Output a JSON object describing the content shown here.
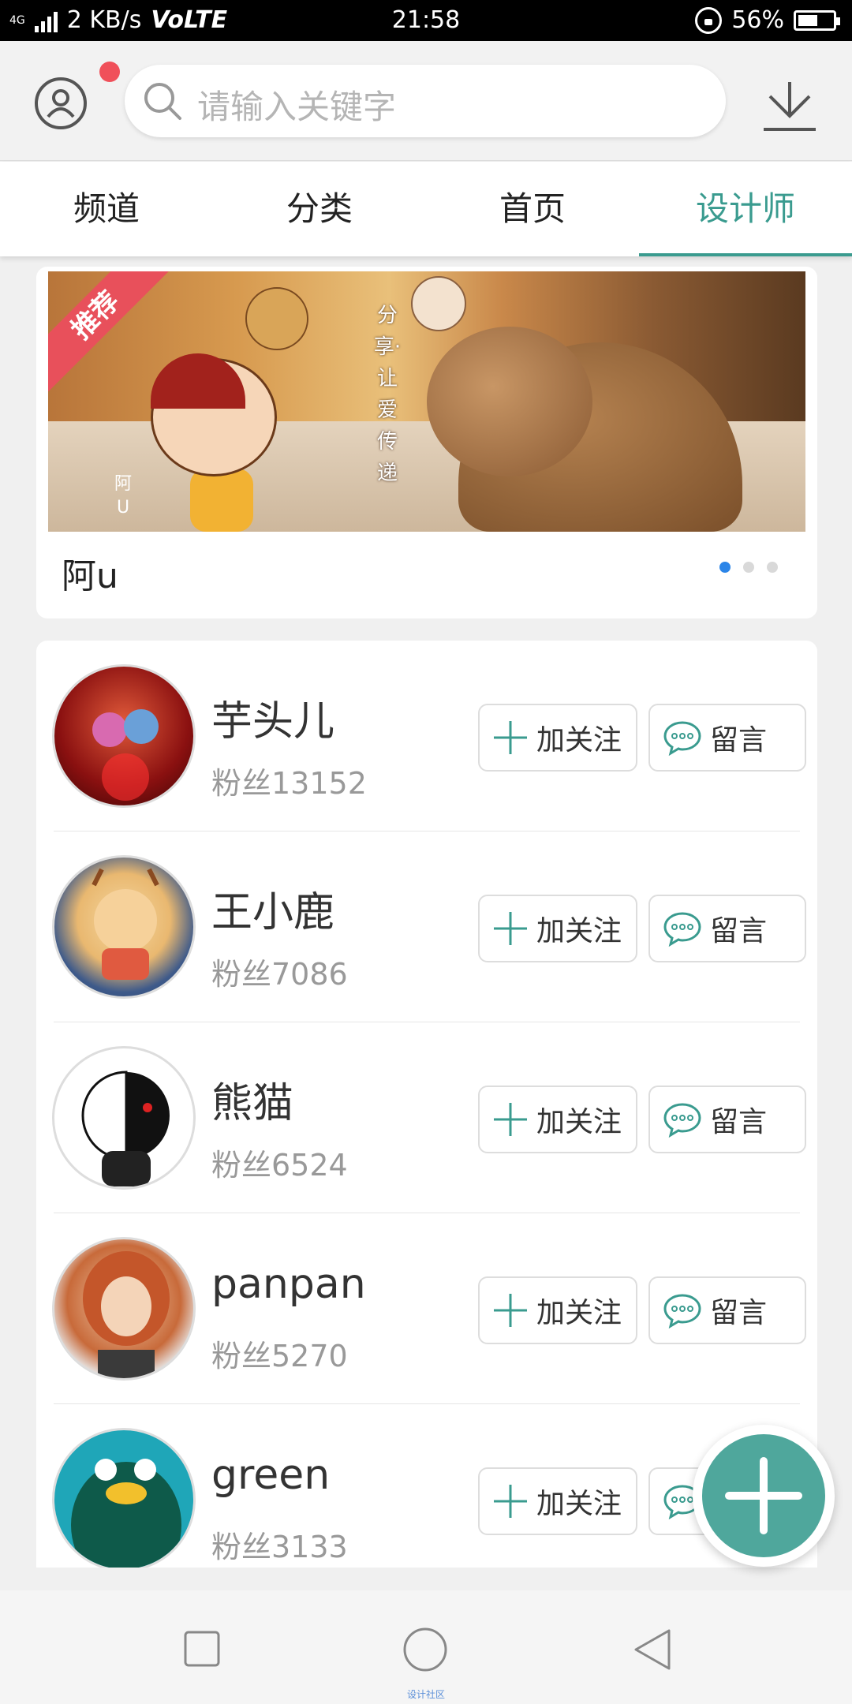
{
  "status_bar": {
    "network": "4G",
    "speed": "2 KB/s",
    "volte": "VoLTE",
    "time": "21:58",
    "battery": "56%",
    "battery_level": 0.56
  },
  "header": {
    "search_placeholder": "请输入关键字"
  },
  "tabs": [
    {
      "label": "频道",
      "active": false
    },
    {
      "label": "分类",
      "active": false
    },
    {
      "label": "首页",
      "active": false
    },
    {
      "label": "设计师",
      "active": true
    }
  ],
  "banner": {
    "ribbon": "推荐",
    "vertical_text": "分享·让爱传递",
    "monkey_caption": "阿U",
    "title": "阿u",
    "page_count": 3,
    "current_page": 1
  },
  "designers": [
    {
      "name": "芋头儿",
      "fans": "粉丝13152"
    },
    {
      "name": "王小鹿",
      "fans": "粉丝7086"
    },
    {
      "name": "熊猫",
      "fans": "粉丝6524"
    },
    {
      "name": "panpan",
      "fans": "粉丝5270"
    },
    {
      "name": "green",
      "fans": "粉丝3133"
    }
  ],
  "buttons": {
    "follow": "加关注",
    "message": "留言"
  },
  "watermark": "设计社区",
  "colors": {
    "accent": "#3a9b8f",
    "fab": "#4fa79c",
    "notification_dot": "#f0505a",
    "ribbon": "#e8505b",
    "page_dot_active": "#2b85e8"
  }
}
